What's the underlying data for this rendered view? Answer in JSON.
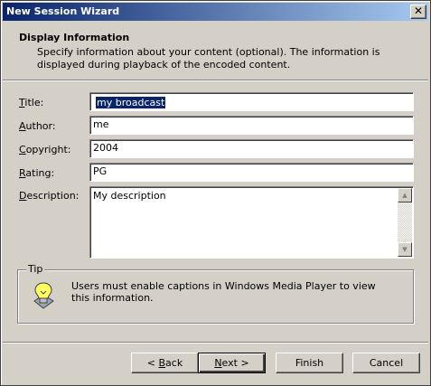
{
  "window": {
    "title": "New Session Wizard",
    "close_glyph": "✕"
  },
  "header": {
    "title": "Display Information",
    "description": "Specify information about your content (optional). The information is displayed during playback of the encoded content."
  },
  "form": {
    "title_label_u": "T",
    "title_label_rest": "itle:",
    "title_value": "my broadcast",
    "author_label_u": "A",
    "author_label_rest": "uthor:",
    "author_value": "me",
    "copyright_label_u": "C",
    "copyright_label_rest": "opyright:",
    "copyright_value": "2004",
    "rating_label_u": "R",
    "rating_label_rest": "ating:",
    "rating_value": "PG",
    "description_label_u": "D",
    "description_label_rest": "escription:",
    "description_value": "My description"
  },
  "tip": {
    "label": "Tip",
    "text": "Users must enable captions in Windows Media Player to view this information.",
    "icon": "lightbulb-tip-icon"
  },
  "buttons": {
    "back_prefix": "< ",
    "back_u": "B",
    "back_rest": "ack",
    "next_u": "N",
    "next_rest": "ext >",
    "finish": "Finish",
    "cancel": "Cancel"
  },
  "colors": {
    "titlebar_start": "#0a246a",
    "titlebar_end": "#a6caf0",
    "face": "#d4d0c8",
    "selection": "#0a246a"
  }
}
